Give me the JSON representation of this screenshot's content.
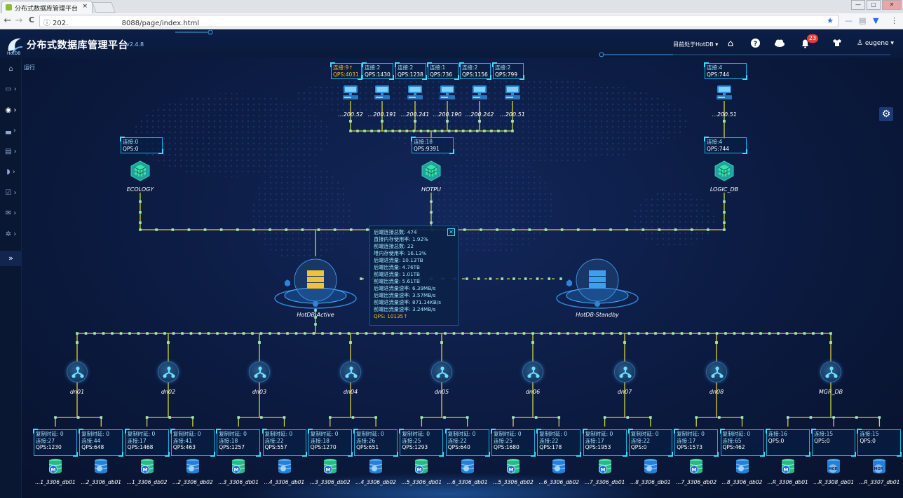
{
  "browser": {
    "tab_title": "分布式数据库管理平台",
    "tab_close": "×",
    "url_start": "202.",
    "url_end": "8088/page/index.html",
    "info_glyph": "ⓘ",
    "star_glyph": "★",
    "back_glyph": "←",
    "forward_glyph": "→",
    "reload_glyph": "C",
    "window_controls": [
      "—",
      "▢",
      "✕"
    ],
    "ext_glyphs": [
      "—",
      "▤",
      "▼",
      "⋮"
    ]
  },
  "header": {
    "logo_text": "HotDB",
    "title": "分布式数据库管理平台",
    "version": "v2.4.8",
    "current_instance": "目前处于HotDB ▾",
    "notification_count": "23",
    "username": "eugene ▾",
    "icons": [
      "home-icon",
      "help-icon",
      "cloud-icon",
      "bell-icon",
      "shirt-icon",
      "user-icon"
    ]
  },
  "sidebar": {
    "items": [
      "home-icon",
      "monitor-icon",
      "eye-icon",
      "chart-icon",
      "database-icon",
      "shield-icon",
      "check-icon",
      "mail-icon",
      "gear-icon"
    ],
    "expand_glyph": "»",
    "crumb": "运行"
  },
  "settings_glyph": "⚙",
  "app_servers": [
    {
      "name": "...200.52",
      "conn": "连接:9↑",
      "qps": "QPS:4031",
      "highlight": true
    },
    {
      "name": "...200.191",
      "conn": "连接:2",
      "qps": "QPS:1430",
      "highlight": false
    },
    {
      "name": "...200.241",
      "conn": "连接:2",
      "qps": "QPS:1238",
      "highlight": false
    },
    {
      "name": "...200.190",
      "conn": "连接:1",
      "qps": "QPS:736",
      "highlight": false
    },
    {
      "name": "...200.242",
      "conn": "连接:2",
      "qps": "QPS:1156",
      "highlight": false
    },
    {
      "name": "...200.51",
      "conn": "连接:2",
      "qps": "QPS:799",
      "highlight": false
    }
  ],
  "right_server": {
    "name": "...200.51",
    "conn": "连接:4",
    "qps": "QPS:744"
  },
  "logic_dbs": [
    {
      "name": "ECOLOGY",
      "conn": "连接:0",
      "qps": "QPS:0"
    },
    {
      "name": "HOTPU",
      "conn": "连接:18",
      "qps": "QPS:9391"
    },
    {
      "name": "LOGIC_DB",
      "conn": "连接:4",
      "qps": "QPS:744"
    }
  ],
  "hotdb": {
    "active": "HotDB-Active",
    "standby": "HotDB-Standby"
  },
  "info_panel": {
    "close": "✕",
    "lines": [
      "后端连接总数: 474",
      "直接内存使用率: 1.92%",
      "前端连接总数: 22",
      "堆内存使用率: 16.13%",
      "后端进流量: 10.13TB",
      "后端出流量: 4.76TB",
      "前端进流量: 1.01TB",
      "前端出流量: 5.61TB",
      "后端进流量速率: 6.39MB/s",
      "后端出流量速率: 3.57MB/s",
      "前端进流量速率: 871.14KB/s",
      "前端出流量速率: 3.24MB/s"
    ],
    "qps": "QPS: 10135↑"
  },
  "datanodes": [
    "dn01",
    "dn02",
    "dn03",
    "dn04",
    "dn05",
    "dn06",
    "dn07",
    "dn08",
    "MGR_DB"
  ],
  "datasources": [
    {
      "name": "...1_3306_db01",
      "l1": "复制时延: 0",
      "l2": "连接:27",
      "l3": "QPS:1230",
      "type": "master"
    },
    {
      "name": "...2_3306_db01",
      "l1": "复制时延: 0",
      "l2": "连接:44",
      "l3": "QPS:648",
      "type": "slave"
    },
    {
      "name": "...1_3306_db02",
      "l1": "复制时延: 0",
      "l2": "连接:17",
      "l3": "QPS:1468",
      "type": "master"
    },
    {
      "name": "...2_3306_db02",
      "l1": "复制时延: 0",
      "l2": "连接:41",
      "l3": "QPS:463",
      "type": "slave"
    },
    {
      "name": "...3_3306_db01",
      "l1": "复制时延: 0",
      "l2": "连接:18",
      "l3": "QPS:1257",
      "type": "master"
    },
    {
      "name": "...4_3306_db01",
      "l1": "复制时延: 0",
      "l2": "连接:22",
      "l3": "QPS:557",
      "type": "slave"
    },
    {
      "name": "...3_3306_db02",
      "l1": "复制时延: 0",
      "l2": "连接:18",
      "l3": "QPS:1270",
      "type": "master"
    },
    {
      "name": "...4_3306_db02",
      "l1": "复制时延: 0",
      "l2": "连接:26",
      "l3": "QPS:651",
      "type": "slave"
    },
    {
      "name": "...5_3306_db01",
      "l1": "复制时延: 0",
      "l2": "连接:25",
      "l3": "QPS:1293",
      "type": "master"
    },
    {
      "name": "...6_3306_db01",
      "l1": "复制时延: 0",
      "l2": "连接:22",
      "l3": "QPS:640",
      "type": "slave"
    },
    {
      "name": "...5_3306_db02",
      "l1": "复制时延: 0",
      "l2": "连接:25",
      "l3": "QPS:1680",
      "type": "master"
    },
    {
      "name": "...6_3306_db02",
      "l1": "复制时延: 0",
      "l2": "连接:22",
      "l3": "QPS:178",
      "type": "slave"
    },
    {
      "name": "...7_3306_db01",
      "l1": "复制时延: 0",
      "l2": "连接:17",
      "l3": "QPS:1953",
      "type": "master"
    },
    {
      "name": "...8_3306_db01",
      "l1": "复制时延: 0",
      "l2": "连接:22",
      "l3": "QPS:0",
      "type": "slave"
    },
    {
      "name": "...7_3306_db02",
      "l1": "复制时延: 0",
      "l2": "连接:17",
      "l3": "QPS:1573",
      "type": "master"
    },
    {
      "name": "...8_3306_db02",
      "l1": "复制时延: 0",
      "l2": "连接:65",
      "l3": "QPS:462",
      "type": "slave"
    },
    {
      "name": "...R_3306_db01",
      "l1": "连接:16",
      "l2": "QPS:0",
      "l3": "",
      "type": "master"
    },
    {
      "name": "...R_3308_db01",
      "l1": "连接:15",
      "l2": "QPS:0",
      "l3": "",
      "type": "mgr"
    },
    {
      "name": "...R_3307_db01",
      "l1": "连接:15",
      "l2": "QPS:0",
      "l3": "",
      "type": "mgr"
    }
  ],
  "db_badges": {
    "master": "M",
    "slave": "",
    "mgr": "MGR"
  },
  "colors": {
    "link": "#d8d23a",
    "accent": "#19b4e6",
    "qps_highlight": "#ffb52b",
    "node_green": "#2fd39a",
    "bg": "#0b1a3a"
  }
}
